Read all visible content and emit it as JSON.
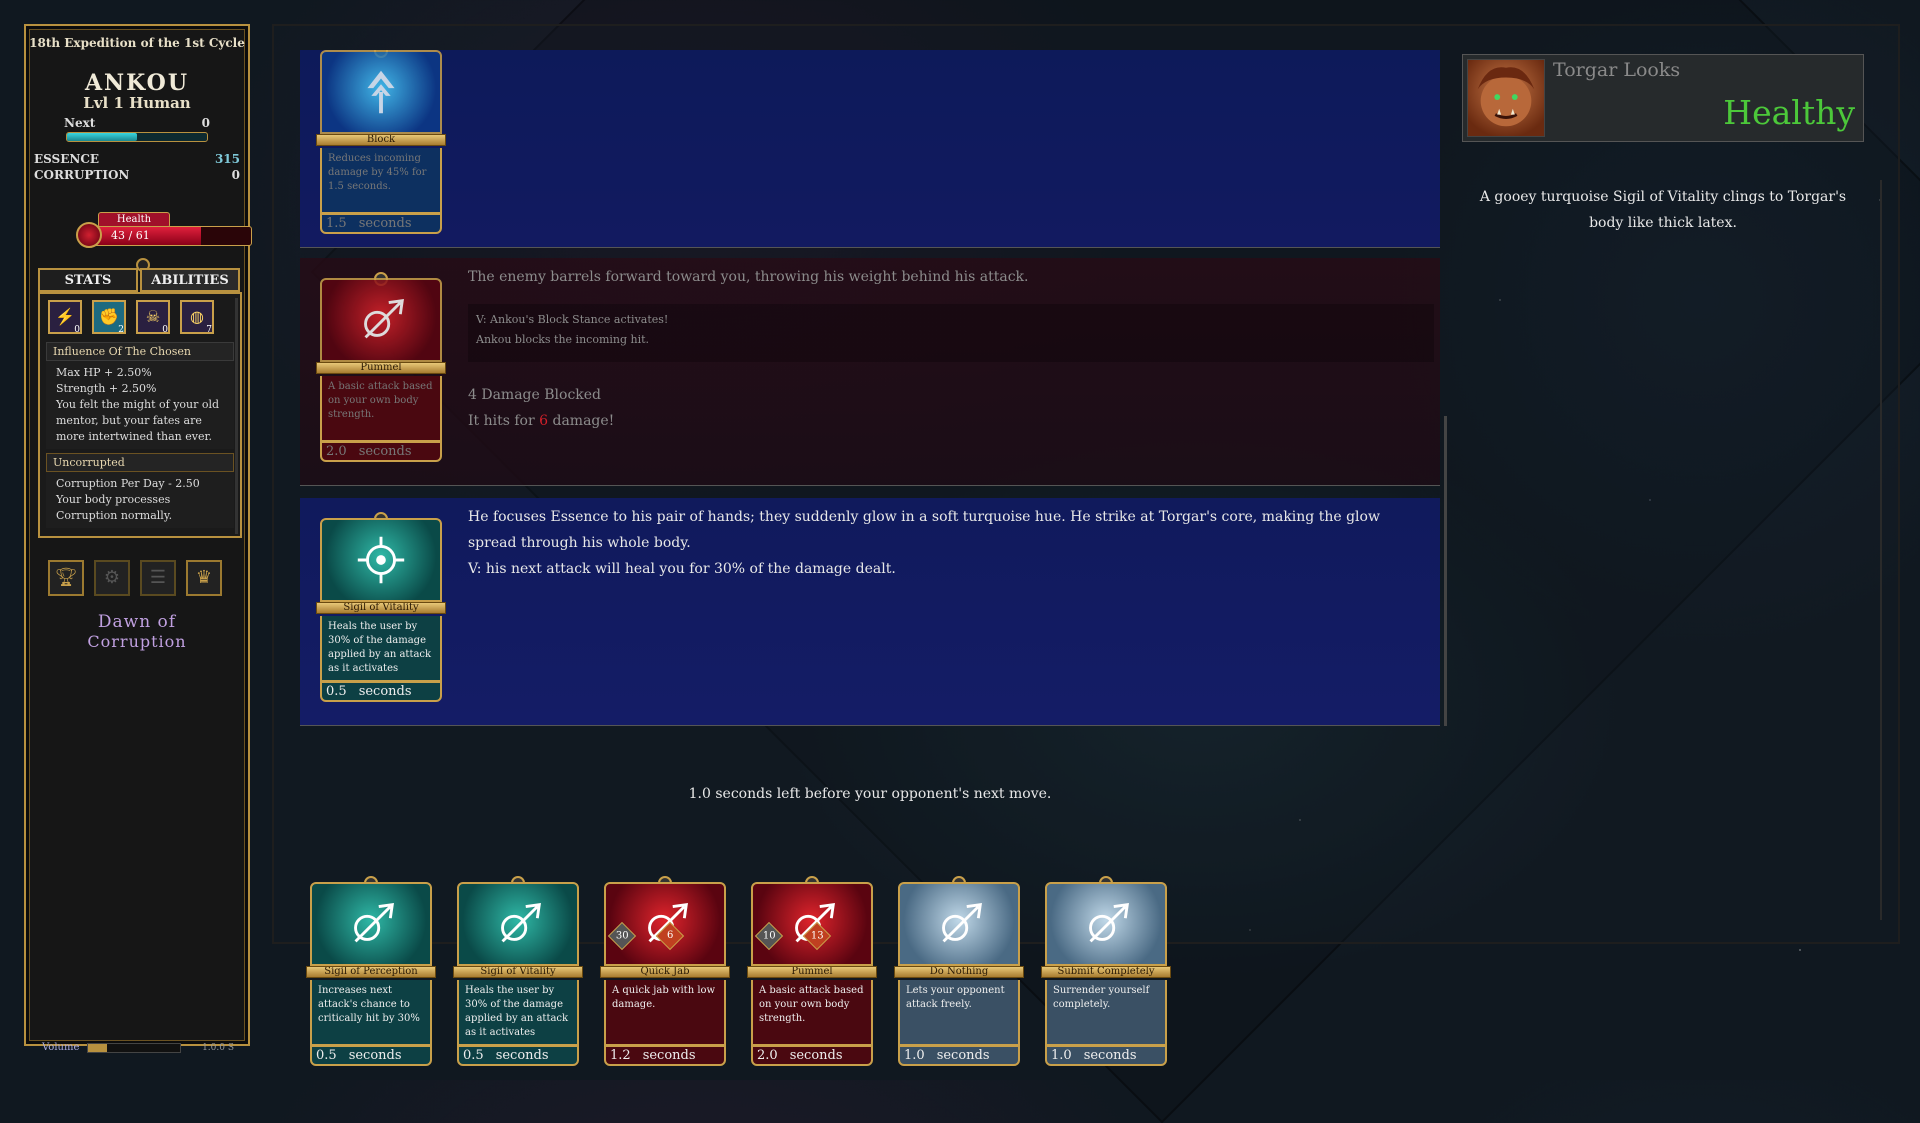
{
  "colors": {
    "accent_gold": "#b8913f",
    "essence": "#7fc9d9",
    "health_red": "#d0202a",
    "enemy_status": "#4cc83a",
    "log_bg_blue": "#121a60"
  },
  "left_panel": {
    "expedition": "18th Expedition of the 1st Cycle",
    "name": "ANKOU",
    "level_line": "Lvl 1 Human",
    "next_label": "Next",
    "next_value": "0",
    "xp_progress": 0.5,
    "essence_label": "ESSENCE",
    "essence_value": "315",
    "corruption_label": "CORRUPTION",
    "corruption_value": "0",
    "health_label": "Health",
    "health_text": "43 / 61",
    "health_current": 43,
    "health_max": 61,
    "tabs": {
      "stats": "STATS",
      "abilities": "ABILITIES"
    },
    "ability_icons": [
      {
        "icon": "lightning-icon",
        "count": "0"
      },
      {
        "icon": "muscle-icon",
        "count": "2"
      },
      {
        "icon": "skull-icon",
        "count": "0"
      },
      {
        "icon": "planet-icon",
        "count": "7"
      }
    ],
    "influence": {
      "title": "Influence Of The Chosen",
      "line1": "Max HP + 2.50%",
      "line2": "Strength + 2.50%",
      "line3": "You felt the might of your old mentor, but your fates are more intertwined than ever."
    },
    "uncorrupted": {
      "title": "Uncorrupted",
      "line1": "Corruption Per Day - 2.50",
      "line2": "Your body processes Corruption normally."
    },
    "menu_icons": [
      "trophy-icon",
      "gears-icon",
      "list-icon",
      "crown-icon"
    ],
    "logo_line1": "Dawn of",
    "logo_line2": "Corruption",
    "volume_label": "Volume",
    "volume_level": 0.2,
    "version": "1.0.0 S"
  },
  "log": [
    {
      "card": {
        "name": "Block",
        "desc": "Reduces incoming damage by 45% for 1.5 seconds.",
        "time": "1.5",
        "unit": "seconds",
        "style": "blue",
        "icon": "block-icon"
      }
    },
    {
      "card": {
        "name": "Pummel",
        "desc": "A basic attack based on your own body strength.",
        "time": "2.0",
        "unit": "seconds",
        "style": "red",
        "icon": "pummel-icon"
      },
      "text": "The enemy barrels forward toward you, throwing his weight behind his attack.",
      "sub1": "V: Ankou's Block Stance activates!",
      "sub2": "Ankou blocks the incoming hit.",
      "blocked": "4 Damage Blocked",
      "hits_pre": "It hits for ",
      "hits_dmg": "6",
      "hits_post": " damage!"
    },
    {
      "card": {
        "name": "Sigil of Vitality",
        "desc": "Heals the user by 30% of the damage applied by an attack as it activates",
        "time": "0.5",
        "unit": "seconds",
        "style": "teal",
        "icon": "sigil-icon"
      },
      "text1": "He focuses Essence to his pair of hands; they suddenly glow in a soft turquoise hue. He strike at Torgar's core, making the glow spread through his whole body.",
      "text2": "V: his next attack will heal you for 30% of the damage dealt."
    }
  ],
  "timer_text": "1.0 seconds left before your opponent's next move.",
  "enemy": {
    "label": "Torgar Looks",
    "status": "Healthy",
    "description": "A gooey turquoise Sigil of Vitality clings to Torgar's body like thick latex."
  },
  "hand": [
    {
      "name": "Sigil of Perception",
      "desc": "Increases next attack's chance to critically hit by 30%",
      "time": "0.5",
      "unit": "seconds",
      "style": "teal"
    },
    {
      "name": "Sigil of Vitality",
      "desc": "Heals the user by 30% of the damage applied by an attack as it activates",
      "time": "0.5",
      "unit": "seconds",
      "style": "teal"
    },
    {
      "name": "Quick Jab",
      "desc": "A quick jab with low damage.",
      "time": "1.2",
      "unit": "seconds",
      "style": "red",
      "speed": "30",
      "power": "6"
    },
    {
      "name": "Pummel",
      "desc": "A basic attack based on your own body strength.",
      "time": "2.0",
      "unit": "seconds",
      "style": "red",
      "speed": "10",
      "power": "13"
    },
    {
      "name": "Do Nothing",
      "desc": "Lets your opponent attack freely.",
      "time": "1.0",
      "unit": "seconds",
      "style": "grey"
    },
    {
      "name": "Submit Completely",
      "desc": "Surrender yourself completely.",
      "time": "1.0",
      "unit": "seconds",
      "style": "grey"
    }
  ]
}
